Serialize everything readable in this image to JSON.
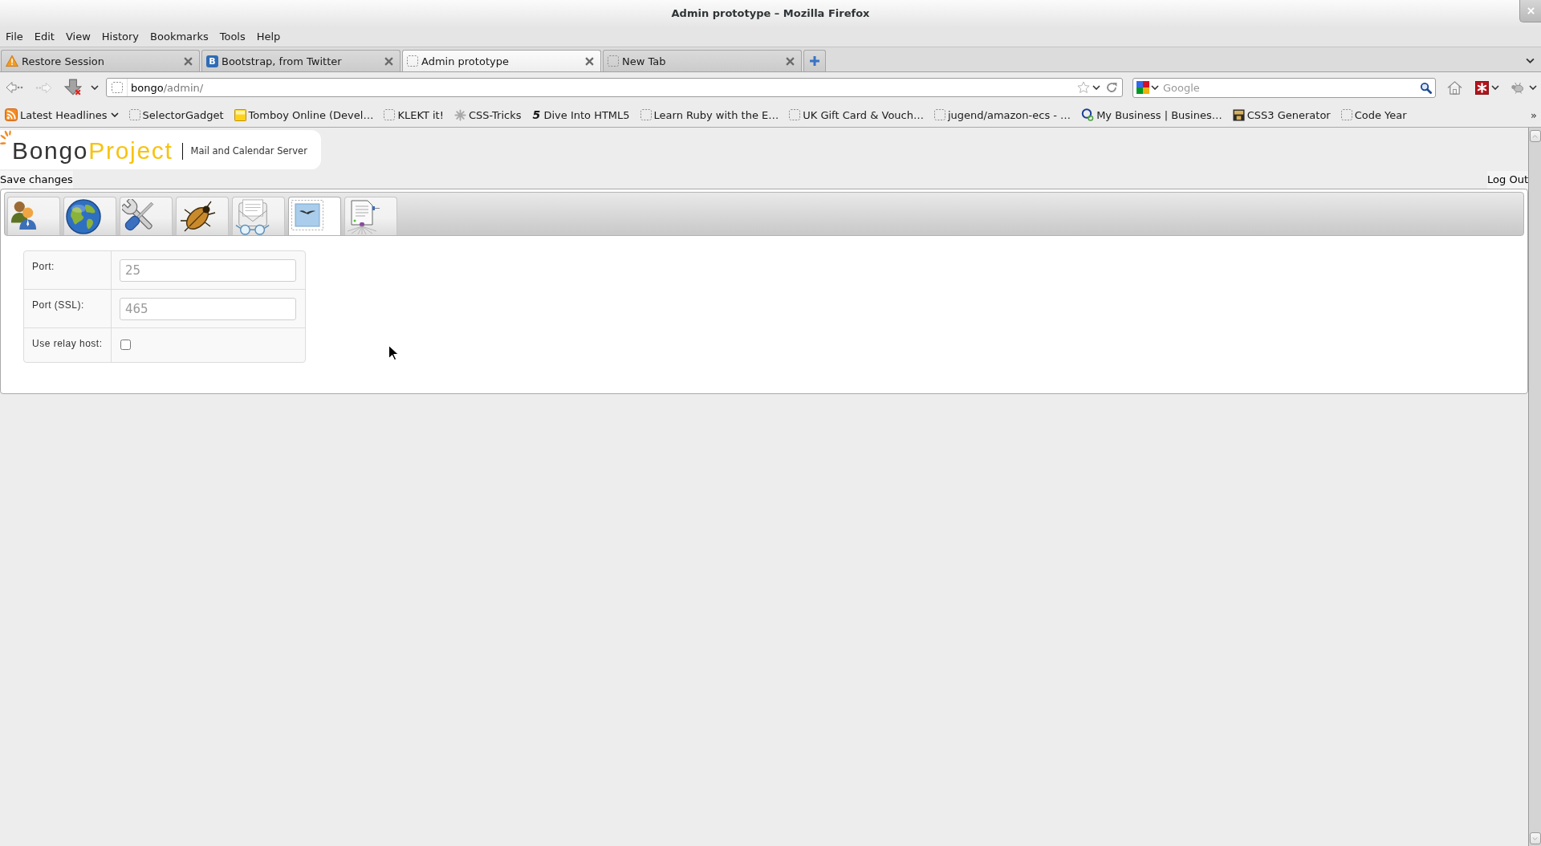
{
  "window": {
    "title": "Admin prototype – Mozilla Firefox"
  },
  "menu_bar": [
    {
      "label": "File"
    },
    {
      "label": "Edit"
    },
    {
      "label": "View"
    },
    {
      "label": "History"
    },
    {
      "label": "Bookmarks"
    },
    {
      "label": "Tools"
    },
    {
      "label": "Help"
    }
  ],
  "tabs": [
    {
      "title": "Restore Session",
      "selected": false
    },
    {
      "title": "Bootstrap, from Twitter",
      "selected": false,
      "favicon_text": "B"
    },
    {
      "title": "Admin prototype",
      "selected": true
    },
    {
      "title": "New Tab",
      "selected": false
    }
  ],
  "navigation": {
    "back": {
      "disabled": false
    },
    "forward": {
      "disabled": true
    },
    "url": {
      "host": "bongo",
      "path": "/admin/"
    },
    "search": {
      "placeholder": "Google"
    }
  },
  "bookmarks": [
    {
      "label": "Latest Headlines",
      "has_menu": true
    },
    {
      "label": "SelectorGadget",
      "has_menu": false
    },
    {
      "label": "Tomboy Online (Devel…",
      "has_menu": false
    },
    {
      "label": "KLEKT it!",
      "has_menu": false
    },
    {
      "label": "CSS-Tricks",
      "has_menu": false
    },
    {
      "label": "Dive Into HTML5",
      "has_menu": false,
      "favicon_text": "5"
    },
    {
      "label": "Learn Ruby with the E…",
      "has_menu": false
    },
    {
      "label": "UK Gift Card & Vouch…",
      "has_menu": false
    },
    {
      "label": "jugend/amazon-ecs - …",
      "has_menu": false
    },
    {
      "label": "My Business | Busines…",
      "has_menu": false
    },
    {
      "label": "CSS3 Generator",
      "has_menu": false
    },
    {
      "label": "Code Year",
      "has_menu": false
    }
  ],
  "bookmarks_overflow": "»",
  "page": {
    "logo": {
      "name_dark": "Bongo",
      "name_accent": "Project",
      "tagline": "Mail and Calendar Server"
    },
    "save_link": "Save changes",
    "logout_link": "Log Out",
    "section_tabs": [
      {
        "selected": false
      },
      {
        "selected": false
      },
      {
        "selected": false
      },
      {
        "selected": false
      },
      {
        "selected": false
      },
      {
        "selected": true
      },
      {
        "selected": false
      }
    ],
    "form": [
      {
        "kind": "text",
        "label": "Port:",
        "placeholder": "25"
      },
      {
        "kind": "text",
        "label": "Port (SSL):",
        "placeholder": "465"
      },
      {
        "kind": "checkbox",
        "label": "Use relay host:",
        "checked": false
      }
    ]
  }
}
